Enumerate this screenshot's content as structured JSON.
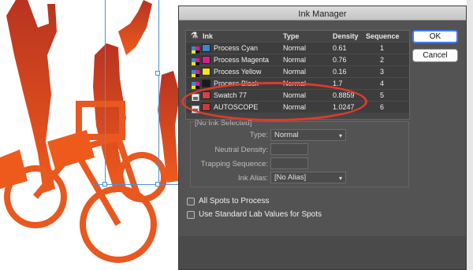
{
  "dialog": {
    "title": "Ink Manager",
    "ok_label": "OK",
    "cancel_label": "Cancel",
    "columns": {
      "ink": "Ink",
      "type": "Type",
      "density": "Density",
      "sequence": "Sequence"
    },
    "inks": [
      {
        "name": "Process Cyan",
        "type": "Normal",
        "density": "0.61",
        "sequence": "1",
        "color": "#3a86d0"
      },
      {
        "name": "Process Magenta",
        "type": "Normal",
        "density": "0.76",
        "sequence": "2",
        "color": "#d6208f"
      },
      {
        "name": "Process Yellow",
        "type": "Normal",
        "density": "0.16",
        "sequence": "3",
        "color": "#f5e60f"
      },
      {
        "name": "Process Black",
        "type": "Normal",
        "density": "1.7",
        "sequence": "4",
        "color": "#1a1a1a"
      },
      {
        "name": "Swatch 77",
        "type": "Normal",
        "density": "0.8859",
        "sequence": "5",
        "color": "#d6414a"
      },
      {
        "name": "AUTOSCOPE",
        "type": "Normal",
        "density": "1.0247",
        "sequence": "6",
        "color": "#cc3a3a"
      }
    ],
    "no_selection_label": "[No Ink Selected]",
    "fields": {
      "type_label": "Type:",
      "type_value": "Normal",
      "neutral_density_label": "Neutral Density:",
      "trapping_sequence_label": "Trapping Sequence:",
      "ink_alias_label": "Ink Alias:",
      "ink_alias_value": "[No Alias]"
    },
    "options": {
      "all_spots_label": "All Spots to Process",
      "standard_lab_label": "Use Standard Lab Values for Spots"
    }
  },
  "colors": {
    "accent": "#3e7cf3",
    "annotation": "#e13a2b",
    "silhouette_dark": "#cd3b28",
    "silhouette_light": "#ee5a1c"
  }
}
